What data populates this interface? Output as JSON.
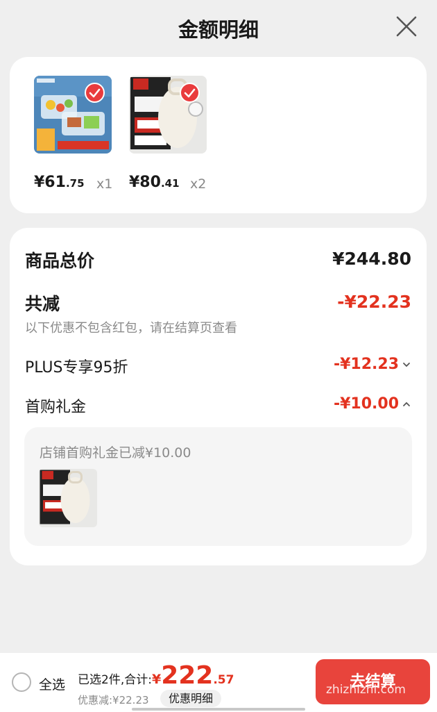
{
  "header": {
    "title": "金额明细"
  },
  "products": [
    {
      "price_main": "¥61",
      "price_dec": ".75",
      "qty": "x1"
    },
    {
      "price_main": "¥80",
      "price_dec": ".41",
      "qty": "x2"
    }
  ],
  "summary": {
    "total_label": "商品总价",
    "total_value": "¥244.80",
    "reduce_label": "共减",
    "reduce_value": "-¥22.23",
    "note": "以下优惠不包含红包，请在结算页查看",
    "plus_label": "PLUS专享95折",
    "plus_value": "-¥12.23",
    "gift_label": "首购礼金",
    "gift_value": "-¥10.00",
    "gift_detail": "店铺首购礼金已减¥10.00"
  },
  "bottom": {
    "select_all": "全选",
    "selected_text": "已选2件,合计:",
    "yen": "¥",
    "total_int": "222",
    "total_dec": ".57",
    "discount": "优惠减:¥22.23",
    "detail_button": "优惠明细",
    "checkout": "去结算",
    "watermark": "zhizhizhi.com"
  },
  "colors": {
    "accent": "#e3321f",
    "card": "#ffffff",
    "background": "#efefef"
  }
}
